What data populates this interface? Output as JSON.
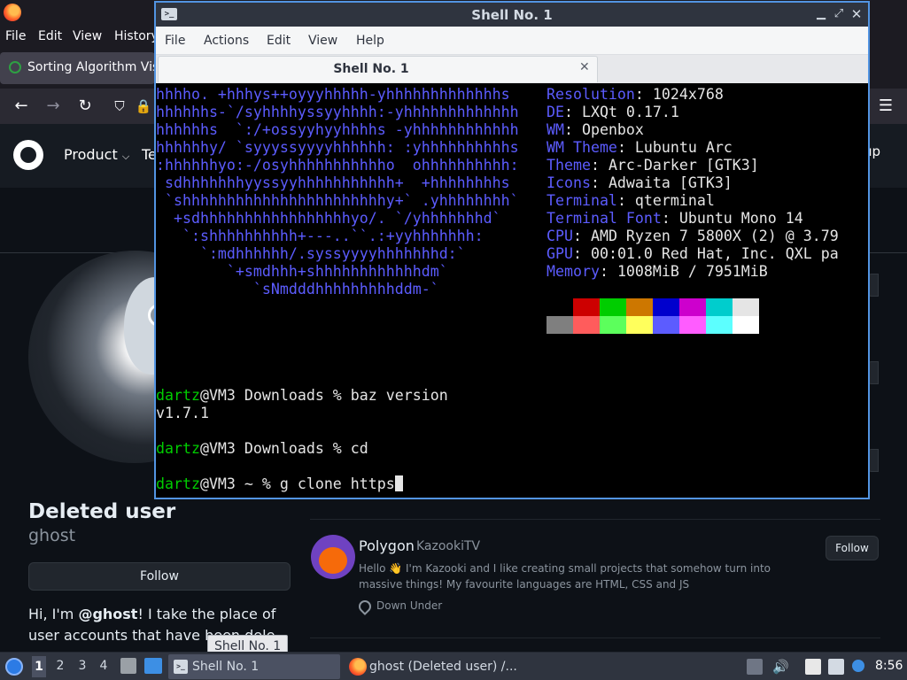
{
  "firefox": {
    "menu": [
      "File",
      "Edit",
      "View",
      "History"
    ],
    "tab_title": "Sorting Algorithm Vis",
    "nav_icons": [
      "back-icon",
      "forward-icon",
      "reload-icon",
      "shield-icon",
      "lock-icon",
      "hamburger-menu-icon"
    ]
  },
  "github": {
    "nav_product": "Product",
    "nav_partial": "Te",
    "signup_partial": "up",
    "profile": {
      "name": "Deleted user",
      "login": "ghost",
      "follow_label": "Follow",
      "bio_prefix": "Hi, I'm ",
      "bio_handle": "@ghost",
      "bio_suffix": "! I take the place of user accounts that have been dele"
    },
    "card": {
      "name": "Polygon",
      "login": "KazookiTV",
      "bio": "Hello 👋 I'm Kazooki and I like creating small projects that somehow turn into massive things! My favourite languages are HTML, CSS and JS",
      "location": "Down Under",
      "follow_label": "Follow"
    }
  },
  "terminal": {
    "window_title": "Shell No. 1",
    "menus": [
      "File",
      "Actions",
      "Edit",
      "View",
      "Help"
    ],
    "tab_label": "Shell No. 1",
    "ascii_art": [
      "hhhho. +hhhys++oyyyhhhhh-yhhhhhhhhhhhhhs",
      "hhhhhhs-`/syhhhhyssyyhhhh:-yhhhhhhhhhhhhh",
      "hhhhhhs  `:/+ossyyhyyhhhhs -yhhhhhhhhhhhh",
      "hhhhhhy/ `syyyssyyyyhhhhhh: :yhhhhhhhhhhs",
      ":hhhhhhyo:-/osyhhhhhhhhhhho  ohhhhhhhhhh:",
      " sdhhhhhhhyyssyyhhhhhhhhhhh+  +hhhhhhhhs",
      " `shhhhhhhhhhhhhhhhhhhhhhhy+` .yhhhhhhhh`",
      "  +sdhhhhhhhhhhhhhhhhhyo/. `/yhhhhhhhd`",
      "   `:shhhhhhhhhh+---..``.:+yyhhhhhhh:",
      "     `:mdhhhhhh/.syssyyyyhhhhhhhd:`",
      "        `+smdhhh+shhhhhhhhhhhhdm`",
      "           `sNmdddhhhhhhhhhddm-`"
    ],
    "info": [
      {
        "key": "Resolution",
        "value": "1024x768"
      },
      {
        "key": "DE",
        "value": "LXQt 0.17.1"
      },
      {
        "key": "WM",
        "value": "Openbox"
      },
      {
        "key": "WM Theme",
        "value": "Lubuntu Arc"
      },
      {
        "key": "Theme",
        "value": "Arc-Darker [GTK3]"
      },
      {
        "key": "Icons",
        "value": "Adwaita [GTK3]"
      },
      {
        "key": "Terminal",
        "value": "qterminal"
      },
      {
        "key": "Terminal Font",
        "value": "Ubuntu Mono 14"
      },
      {
        "key": "CPU",
        "value": "AMD Ryzen 7 5800X (2) @ 3.79"
      },
      {
        "key": "GPU",
        "value": "00:01.0 Red Hat, Inc. QXL pa"
      },
      {
        "key": "Memory",
        "value": "1008MiB / 7951MiB"
      }
    ],
    "palette_top": [
      "#000000",
      "#cd0000",
      "#00cd00",
      "#cd7700",
      "#0000cd",
      "#cd00cd",
      "#00cdcd",
      "#e5e5e5"
    ],
    "palette_bottom": [
      "#7f7f7f",
      "#ff5c5c",
      "#5cff5c",
      "#ffff5c",
      "#5c5cff",
      "#ff5cff",
      "#5cffff",
      "#ffffff"
    ],
    "session": {
      "user": "dartz",
      "line1_rest": "@VM3 Downloads % baz version",
      "output1": "v1.7.1",
      "line2_rest": "@VM3 Downloads % cd",
      "line3_rest": "@VM3 ~ % g clone https"
    }
  },
  "tooltip": "Shell No. 1",
  "taskbar": {
    "workspaces": [
      "1",
      "2",
      "3",
      "4"
    ],
    "task1_label": "Shell No. 1",
    "task2_label": "ghost (Deleted user) /...",
    "clock": "8:56"
  }
}
